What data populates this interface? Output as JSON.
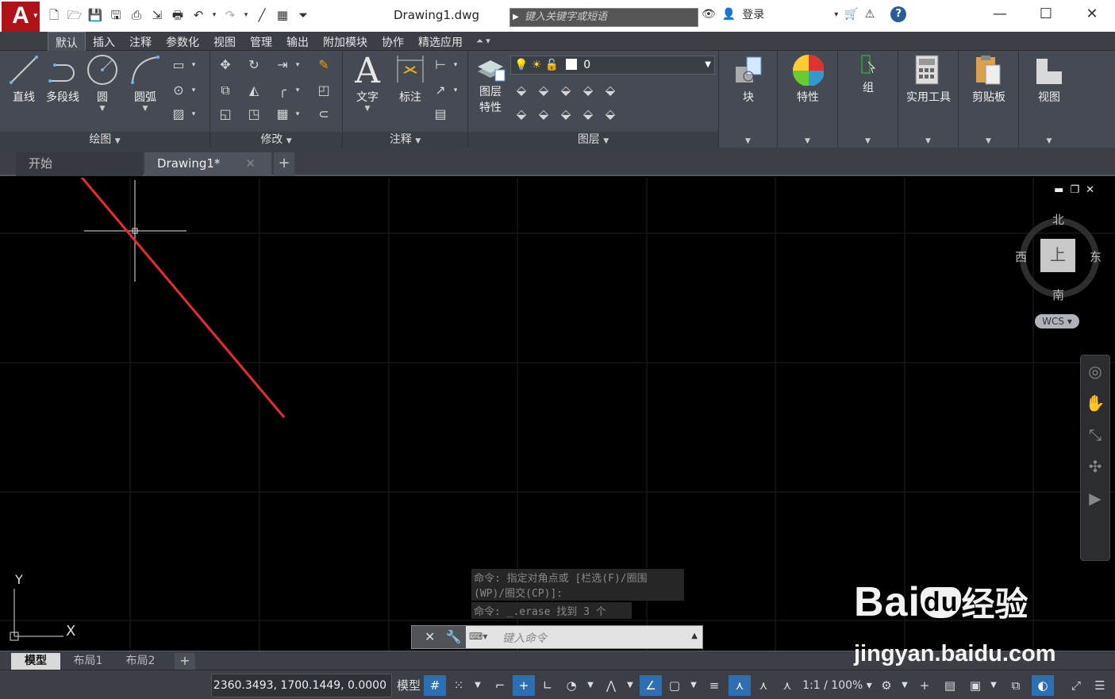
{
  "titlebar": {
    "app_logo": "A",
    "document_title": "Drawing1.dwg",
    "search_placeholder": "键入关键字或短语",
    "login_label": "登录",
    "help_icon": "?"
  },
  "menu": {
    "tabs": [
      "默认",
      "插入",
      "注释",
      "参数化",
      "视图",
      "管理",
      "输出",
      "附加模块",
      "协作",
      "精选应用"
    ]
  },
  "ribbon": {
    "draw": {
      "title": "绘图",
      "line": "直线",
      "polyline": "多段线",
      "circle": "圆",
      "arc": "圆弧"
    },
    "modify": {
      "title": "修改"
    },
    "annotation": {
      "title": "注释",
      "text": "文字",
      "dimension": "标注"
    },
    "layers": {
      "title": "图层",
      "layer_props": "图层\n特性",
      "layer_props_1": "图层",
      "layer_props_2": "特性",
      "current_layer": "0"
    },
    "block": "块",
    "properties": "特性",
    "group": "组",
    "utilities": "实用工具",
    "clipboard": "剪贴板",
    "view": "视图"
  },
  "doc_tabs": {
    "start": "开始",
    "drawing": "Drawing1*"
  },
  "viewcube": {
    "north": "北",
    "south": "南",
    "east": "东",
    "west": "西",
    "top": "上",
    "wcs": "WCS"
  },
  "command": {
    "history_1": "命令: 指定对角点或 [栏选(F)/圈围",
    "history_2": "(WP)/圈交(CP)]:",
    "history_3": "命令: _.erase 找到 3 个",
    "placeholder": "键入命令"
  },
  "ucs": {
    "x": "X",
    "y": "Y"
  },
  "layout_tabs": [
    "模型",
    "布局1",
    "布局2"
  ],
  "status": {
    "coords": "2360.3493, 1700.1449, 0.0000",
    "model": "模型",
    "scale": "1:1 / 100%"
  },
  "watermark": {
    "brand_latin": "Bai",
    "brand_paw": "du",
    "brand_cn": "经验",
    "url": "jingyan.baidu.com"
  }
}
